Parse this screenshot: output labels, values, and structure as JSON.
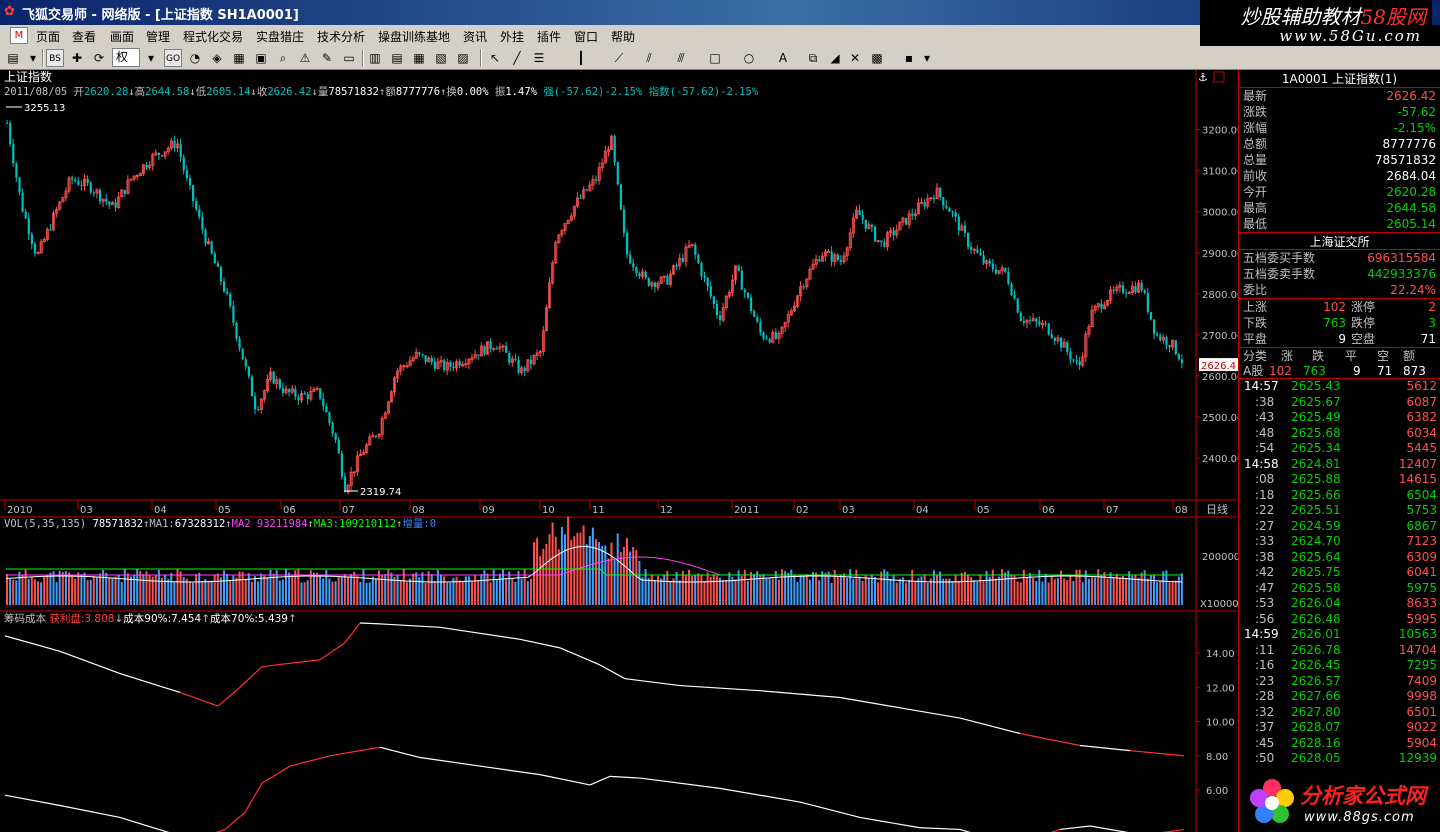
{
  "window": {
    "title": "飞狐交易师 - 网络版 - [上证指数 SH1A0001]",
    "brand_line1_prefix": "炒股辅助教材",
    "brand_line1_em": "58股网",
    "brand_line2": "www.58Gu.com"
  },
  "menu": {
    "logo": "M",
    "items": [
      "页面",
      "查看",
      "画面",
      "管理",
      "程式化交易",
      "实盘猎庄",
      "技术分析",
      "操盘训练基地",
      "资讯",
      "外挂",
      "插件",
      "窗口",
      "帮助"
    ]
  },
  "toolbar": {
    "rights_combo": "权"
  },
  "main_chart": {
    "security_name": "上证指数",
    "info": {
      "date": "2011/08/05",
      "open_label": "开",
      "open": "2620.28",
      "high_label": "高",
      "high": "2644.58",
      "low_label": "低",
      "low": "2605.14",
      "close_label": "收",
      "close": "2626.42",
      "volume_label": "量",
      "volume": "78571832",
      "amount_label": "额",
      "amount": "8777776",
      "turnover_label": "换",
      "turnover": "0.00%",
      "amplitude_label": "振",
      "amplitude": "1.47%",
      "strength": "强(-57.62)-2.15%",
      "index_change": "指数(-57.62)-2.15%"
    },
    "max_label": "3255.13",
    "min_label": "2319.74",
    "price_axis": [
      "3200.00",
      "3100.00",
      "3000.00",
      "2900.00",
      "2800.00",
      "2700.00",
      "2600.00",
      "2500.00",
      "2400.00"
    ],
    "current_marker": "2626.4",
    "period_label": "日线"
  },
  "time_axis": [
    "2010",
    "03",
    "04",
    "05",
    "06",
    "07",
    "08",
    "09",
    "10",
    "11",
    "12",
    "2011",
    "02",
    "03",
    "04",
    "05",
    "06",
    "07",
    "08"
  ],
  "volume_panel": {
    "params": "VOL(5,35,135)",
    "value": "78571832",
    "ma1_label": "MA1:",
    "ma1": "67328312",
    "ma2_label": "MA2",
    "ma2": "93211984",
    "ma3_label": "MA3:",
    "ma3": "109210112",
    "incr_label": "增量:",
    "incr": "0",
    "axis_label": "200000",
    "unit_label": "X10000"
  },
  "cost_panel": {
    "name": "筹码成本",
    "profit_label": "获利盘:",
    "profit": "3.808",
    "cost90_label": "成本90%:",
    "cost90": "7.454",
    "cost70_label": "成本70%:",
    "cost70": "5.439",
    "axis": [
      "14.00",
      "12.00",
      "10.00",
      "8.00",
      "6.00"
    ]
  },
  "chart_data": {
    "type": "candlestick",
    "title": "上证指数",
    "ylim": [
      2319.74,
      3255.13
    ],
    "x_ticks": [
      "2010",
      "03",
      "04",
      "05",
      "06",
      "07",
      "08",
      "09",
      "10",
      "11",
      "12",
      "2011",
      "02",
      "03",
      "04",
      "05",
      "06",
      "07",
      "08"
    ],
    "close_by_tick": [
      3230,
      2960,
      3140,
      2900,
      2560,
      2550,
      2620,
      2650,
      2680,
      3150,
      2860,
      2820,
      2740,
      2880,
      3000,
      2870,
      2720,
      2730,
      2626.42
    ],
    "last": {
      "open": 2620.28,
      "high": 2644.58,
      "low": 2605.14,
      "close": 2626.42
    }
  },
  "quote_panel": {
    "header": "1A0001 上证指数(1)",
    "rows": [
      {
        "k": "最新",
        "v": "2626.42",
        "c": "red"
      },
      {
        "k": "涨跌",
        "v": "-57.62",
        "c": "green"
      },
      {
        "k": "涨幅",
        "v": "-2.15%",
        "c": "green"
      },
      {
        "k": "总额",
        "v": "8777776",
        "c": "white"
      },
      {
        "k": "总量",
        "v": "78571832",
        "c": "white"
      },
      {
        "k": "前收",
        "v": "2684.04",
        "c": "white"
      },
      {
        "k": "今开",
        "v": "2620.28",
        "c": "green"
      },
      {
        "k": "最高",
        "v": "2644.58",
        "c": "green"
      },
      {
        "k": "最低",
        "v": "2605.14",
        "c": "green"
      }
    ],
    "exchange": "上海证交所",
    "rows2": [
      {
        "k": "五档委买手数",
        "v": "696315584",
        "c": "red"
      },
      {
        "k": "五档委卖手数",
        "v": "442933376",
        "c": "green"
      },
      {
        "k": "委比",
        "v": "22.24%",
        "c": "red"
      }
    ],
    "breadth": [
      {
        "k1": "上涨",
        "v1": "102",
        "c1": "red",
        "k2": "涨停",
        "v2": "2",
        "c2": "red"
      },
      {
        "k1": "下跌",
        "v1": "763",
        "c1": "green",
        "k2": "跌停",
        "v2": "3",
        "c2": "green"
      },
      {
        "k1": "平盘",
        "v1": "9",
        "c1": "white",
        "k2": "空盘",
        "v2": "71",
        "c2": "white"
      }
    ],
    "class_head": [
      "分类",
      "涨",
      "跌",
      "平",
      "空",
      "额"
    ],
    "class_row": [
      "A股",
      "102",
      "763",
      "9",
      "71",
      "873"
    ],
    "ticks": [
      {
        "t": "14:57",
        "p": "2625.43",
        "v": "5612",
        "vc": "red"
      },
      {
        "t": ":38",
        "p": "2625.67",
        "v": "6087",
        "vc": "red"
      },
      {
        "t": ":43",
        "p": "2625.49",
        "v": "6382",
        "vc": "red"
      },
      {
        "t": ":48",
        "p": "2625.68",
        "v": "6034",
        "vc": "red"
      },
      {
        "t": ":54",
        "p": "2625.34",
        "v": "5445",
        "vc": "red"
      },
      {
        "t": "14:58",
        "p": "2624.81",
        "v": "12407",
        "vc": "red"
      },
      {
        "t": ":08",
        "p": "2625.88",
        "v": "14615",
        "vc": "red"
      },
      {
        "t": ":18",
        "p": "2625.66",
        "v": "6504",
        "vc": "green"
      },
      {
        "t": ":22",
        "p": "2625.51",
        "v": "5753",
        "vc": "green"
      },
      {
        "t": ":27",
        "p": "2624.59",
        "v": "6867",
        "vc": "green"
      },
      {
        "t": ":33",
        "p": "2624.70",
        "v": "7123",
        "vc": "red"
      },
      {
        "t": ":38",
        "p": "2625.64",
        "v": "6309",
        "vc": "red"
      },
      {
        "t": ":42",
        "p": "2625.75",
        "v": "6041",
        "vc": "red"
      },
      {
        "t": ":47",
        "p": "2625.58",
        "v": "5975",
        "vc": "green"
      },
      {
        "t": ":53",
        "p": "2626.04",
        "v": "8633",
        "vc": "red"
      },
      {
        "t": ":56",
        "p": "2626.48",
        "v": "5995",
        "vc": "red"
      },
      {
        "t": "14:59",
        "p": "2626.01",
        "v": "10563",
        "vc": "green"
      },
      {
        "t": ":11",
        "p": "2626.78",
        "v": "14704",
        "vc": "red"
      },
      {
        "t": ":16",
        "p": "2626.45",
        "v": "7295",
        "vc": "green"
      },
      {
        "t": ":23",
        "p": "2626.57",
        "v": "7409",
        "vc": "red"
      },
      {
        "t": ":28",
        "p": "2627.66",
        "v": "9998",
        "vc": "red"
      },
      {
        "t": ":32",
        "p": "2627.80",
        "v": "6501",
        "vc": "red"
      },
      {
        "t": ":37",
        "p": "2628.07",
        "v": "9022",
        "vc": "red"
      },
      {
        "t": ":45",
        "p": "2628.16",
        "v": "5904",
        "vc": "red"
      },
      {
        "t": ":50",
        "p": "2628.05",
        "v": "12939",
        "vc": "green"
      }
    ]
  },
  "watermark": {
    "line1": "分析家公式网",
    "line2": "www.88gs.com"
  },
  "colors": {
    "up": "#ff5050",
    "down": "#00c0c0",
    "grid": "#c00000",
    "axis_text": "#c0c0c0"
  }
}
